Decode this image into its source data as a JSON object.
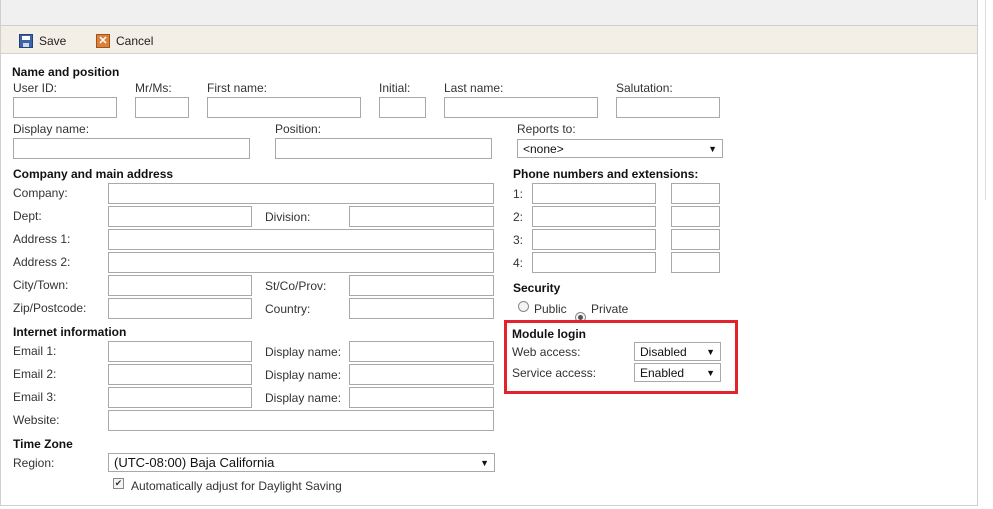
{
  "toolbar": {
    "save_label": "Save",
    "cancel_label": "Cancel"
  },
  "name_section": {
    "heading": "Name and position",
    "user_id_label": "User ID:",
    "mrms_label": "Mr/Ms:",
    "first_name_label": "First name:",
    "initial_label": "Initial:",
    "last_name_label": "Last name:",
    "salutation_label": "Salutation:",
    "display_name_label": "Display name:",
    "position_label": "Position:",
    "reports_to_label": "Reports to:",
    "reports_to_value": "<none>"
  },
  "company_section": {
    "heading": "Company and main address",
    "company_label": "Company:",
    "dept_label": "Dept:",
    "division_label": "Division:",
    "address1_label": "Address 1:",
    "address2_label": "Address 2:",
    "city_label": "City/Town:",
    "state_label": "St/Co/Prov:",
    "zip_label": "Zip/Postcode:",
    "country_label": "Country:"
  },
  "phone_section": {
    "heading": "Phone numbers and extensions:",
    "rows": [
      "1:",
      "2:",
      "3:",
      "4:"
    ]
  },
  "security": {
    "heading": "Security",
    "public_label": "Public",
    "private_label": "Private",
    "selected": "Private"
  },
  "module_login": {
    "heading": "Module login",
    "web_access_label": "Web access:",
    "web_access_value": "Disabled",
    "service_access_label": "Service access:",
    "service_access_value": "Enabled",
    "highlight_color": "#e3232b"
  },
  "internet_section": {
    "heading": "Internet information",
    "email1_label": "Email 1:",
    "email2_label": "Email 2:",
    "email3_label": "Email 3:",
    "display_name_label": "Display name:",
    "website_label": "Website:"
  },
  "timezone": {
    "heading": "Time Zone",
    "region_label": "Region:",
    "region_value": "(UTC-08:00) Baja California",
    "dst_label": "Automatically adjust for Daylight Saving",
    "dst_checked": true
  },
  "icons": {
    "save": "save-disk-icon",
    "cancel": "cancel-x-icon",
    "dropdown": "chevron-down-icon"
  }
}
